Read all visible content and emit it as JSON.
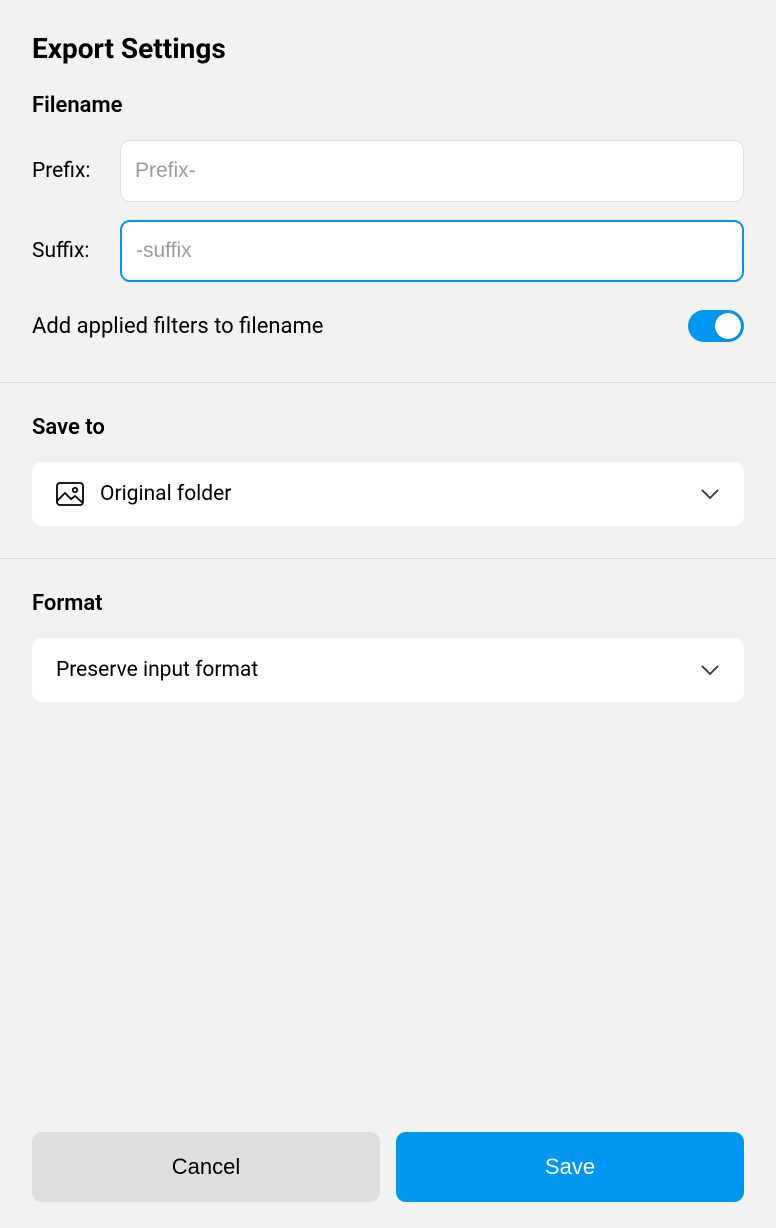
{
  "title": "Export Settings",
  "filename": {
    "heading": "Filename",
    "prefix_label": "Prefix:",
    "prefix_placeholder": "Prefix-",
    "prefix_value": "",
    "suffix_label": "Suffix:",
    "suffix_placeholder": "-suffix",
    "suffix_value": "",
    "toggle_label": "Add applied filters to filename",
    "toggle_on": true
  },
  "save_to": {
    "heading": "Save to",
    "selected": "Original folder"
  },
  "format": {
    "heading": "Format",
    "selected": "Preserve input format"
  },
  "footer": {
    "cancel": "Cancel",
    "save": "Save"
  }
}
